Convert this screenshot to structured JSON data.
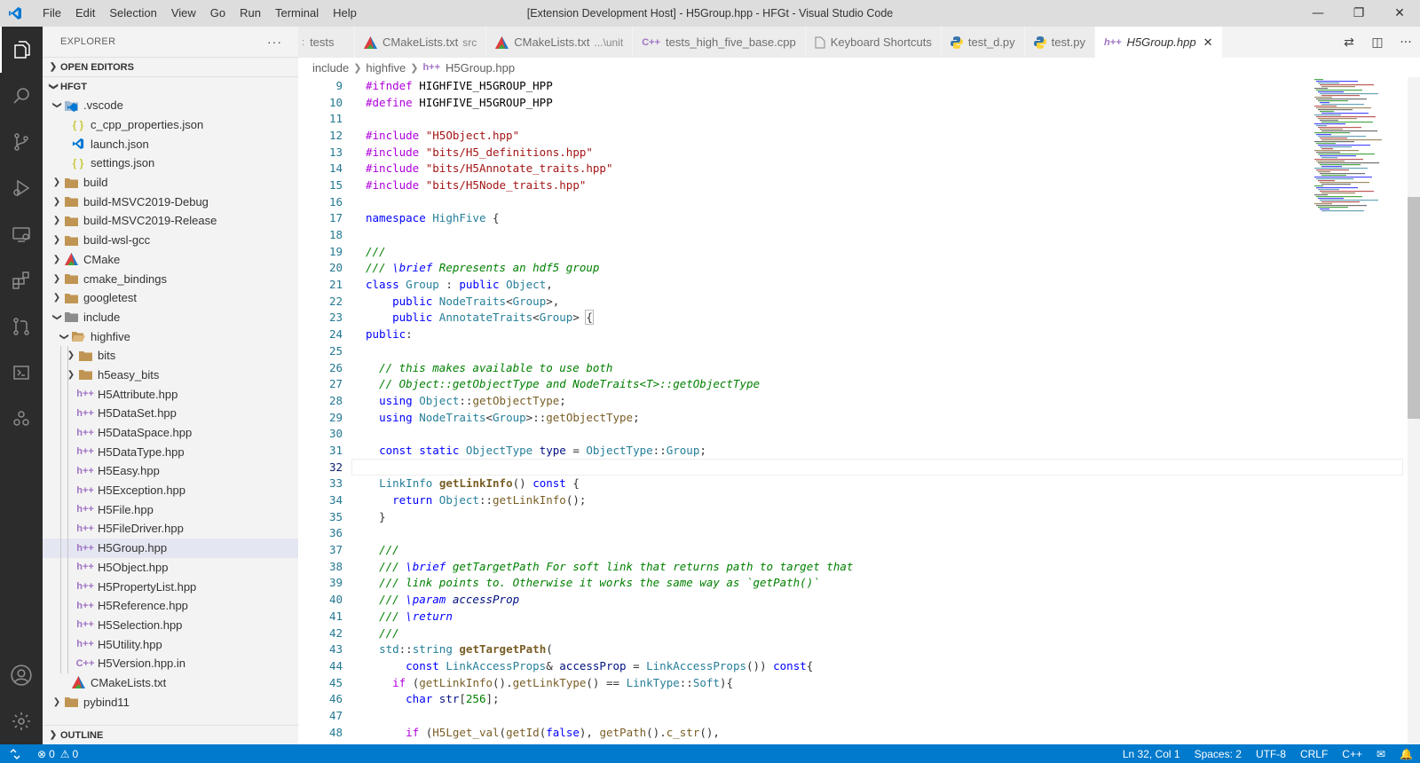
{
  "titlebar": {
    "menu": [
      "File",
      "Edit",
      "Selection",
      "View",
      "Go",
      "Run",
      "Terminal",
      "Help"
    ],
    "title": "[Extension Development Host] - H5Group.hpp - HFGt - Visual Studio Code"
  },
  "sidebar": {
    "header": "EXPLORER",
    "open_editors": "OPEN EDITORS",
    "workspace": "HFGT",
    "outline": "OUTLINE",
    "tree": [
      {
        "label": ".vscode",
        "depth": 1,
        "kind": "folder-vscode",
        "expanded": true
      },
      {
        "label": "c_cpp_properties.json",
        "depth": 2,
        "kind": "json"
      },
      {
        "label": "launch.json",
        "depth": 2,
        "kind": "vscode"
      },
      {
        "label": "settings.json",
        "depth": 2,
        "kind": "json"
      },
      {
        "label": "build",
        "depth": 1,
        "kind": "folder",
        "expanded": false
      },
      {
        "label": "build-MSVC2019-Debug",
        "depth": 1,
        "kind": "folder",
        "expanded": false
      },
      {
        "label": "build-MSVC2019-Release",
        "depth": 1,
        "kind": "folder",
        "expanded": false
      },
      {
        "label": "build-wsl-gcc",
        "depth": 1,
        "kind": "folder",
        "expanded": false
      },
      {
        "label": "CMake",
        "depth": 1,
        "kind": "folder-cmake",
        "expanded": false
      },
      {
        "label": "cmake_bindings",
        "depth": 1,
        "kind": "folder",
        "expanded": false
      },
      {
        "label": "googletest",
        "depth": 1,
        "kind": "folder",
        "expanded": false
      },
      {
        "label": "include",
        "depth": 1,
        "kind": "folder-include",
        "expanded": true
      },
      {
        "label": "highfive",
        "depth": 2,
        "kind": "folder-open",
        "expanded": true
      },
      {
        "label": "bits",
        "depth": 3,
        "kind": "folder",
        "expanded": false
      },
      {
        "label": "h5easy_bits",
        "depth": 3,
        "kind": "folder",
        "expanded": false
      },
      {
        "label": "H5Attribute.hpp",
        "depth": 3,
        "kind": "hpp"
      },
      {
        "label": "H5DataSet.hpp",
        "depth": 3,
        "kind": "hpp"
      },
      {
        "label": "H5DataSpace.hpp",
        "depth": 3,
        "kind": "hpp"
      },
      {
        "label": "H5DataType.hpp",
        "depth": 3,
        "kind": "hpp"
      },
      {
        "label": "H5Easy.hpp",
        "depth": 3,
        "kind": "hpp"
      },
      {
        "label": "H5Exception.hpp",
        "depth": 3,
        "kind": "hpp"
      },
      {
        "label": "H5File.hpp",
        "depth": 3,
        "kind": "hpp"
      },
      {
        "label": "H5FileDriver.hpp",
        "depth": 3,
        "kind": "hpp"
      },
      {
        "label": "H5Group.hpp",
        "depth": 3,
        "kind": "hpp",
        "selected": true
      },
      {
        "label": "H5Object.hpp",
        "depth": 3,
        "kind": "hpp"
      },
      {
        "label": "H5PropertyList.hpp",
        "depth": 3,
        "kind": "hpp"
      },
      {
        "label": "H5Reference.hpp",
        "depth": 3,
        "kind": "hpp"
      },
      {
        "label": "H5Selection.hpp",
        "depth": 3,
        "kind": "hpp"
      },
      {
        "label": "H5Utility.hpp",
        "depth": 3,
        "kind": "hpp"
      },
      {
        "label": "H5Version.hpp.in",
        "depth": 3,
        "kind": "cpp"
      },
      {
        "label": "CMakeLists.txt",
        "depth": 2,
        "kind": "cmake"
      },
      {
        "label": "pybind11",
        "depth": 1,
        "kind": "folder",
        "expanded": false
      }
    ]
  },
  "tabs": [
    {
      "label": "tests",
      "kind": "partial",
      "desc": ""
    },
    {
      "label": "CMakeLists.txt",
      "kind": "cmake",
      "desc": "src"
    },
    {
      "label": "CMakeLists.txt",
      "kind": "cmake",
      "desc": "...\\unit"
    },
    {
      "label": "tests_high_five_base.cpp",
      "kind": "cpp",
      "desc": ""
    },
    {
      "label": "Keyboard Shortcuts",
      "kind": "file",
      "desc": ""
    },
    {
      "label": "test_d.py",
      "kind": "python",
      "desc": ""
    },
    {
      "label": "test.py",
      "kind": "python",
      "desc": ""
    },
    {
      "label": "H5Group.hpp",
      "kind": "hpp",
      "desc": "",
      "active": true
    }
  ],
  "breadcrumb": [
    "include",
    "highfive",
    "H5Group.hpp"
  ],
  "editor": {
    "current_line": 32,
    "lines": [
      {
        "n": 9,
        "html": "<span class='p'>#ifndef</span> <span class='d'>HIGHFIVE_H5GROUP_HPP</span>"
      },
      {
        "n": 10,
        "html": "<span class='p'>#define</span> <span class='d'>HIGHFIVE_H5GROUP_HPP</span>"
      },
      {
        "n": 11,
        "html": ""
      },
      {
        "n": 12,
        "html": "<span class='p'>#include</span> <span class='s'>\"H5Object.hpp\"</span>"
      },
      {
        "n": 13,
        "html": "<span class='p'>#include</span> <span class='s'>\"bits/H5_definitions.hpp\"</span>"
      },
      {
        "n": 14,
        "html": "<span class='p'>#include</span> <span class='s'>\"bits/H5Annotate_traits.hpp\"</span>"
      },
      {
        "n": 15,
        "html": "<span class='p'>#include</span> <span class='s'>\"bits/H5Node_traits.hpp\"</span>"
      },
      {
        "n": 16,
        "html": ""
      },
      {
        "n": 17,
        "html": "<span class='k'>namespace</span> <span class='t'>HighFive</span> {"
      },
      {
        "n": 18,
        "html": ""
      },
      {
        "n": 19,
        "html": "<span class='cmt'>///</span>"
      },
      {
        "n": 20,
        "html": "<span class='cmt'>/// </span><span class='k' style='font-style:italic'>\\brief</span><span class='cmt'> Represents an hdf5 group</span>"
      },
      {
        "n": 21,
        "html": "<span class='k'>class</span> <span class='t'>Group</span> : <span class='k'>public</span> <span class='t'>Object</span>,"
      },
      {
        "n": 22,
        "html": "    <span class='k'>public</span> <span class='t'>NodeTraits</span>&lt;<span class='t'>Group</span>&gt;,"
      },
      {
        "n": 23,
        "html": "    <span class='k'>public</span> <span class='t'>AnnotateTraits</span>&lt;<span class='t'>Group</span>&gt; <span style='outline:1px solid #b9b9b9'>{</span>"
      },
      {
        "n": 24,
        "html": "<span class='k'>public</span>:"
      },
      {
        "n": 25,
        "html": ""
      },
      {
        "n": 26,
        "html": "  <span class='cmt'>// this makes available to use both</span>"
      },
      {
        "n": 27,
        "html": "  <span class='cmt'>// Object::getObjectType and NodeTraits&lt;T&gt;::getObjectType</span>"
      },
      {
        "n": 28,
        "html": "  <span class='k'>using</span> <span class='t'>Object</span>::<span class='f'>getObjectType</span>;"
      },
      {
        "n": 29,
        "html": "  <span class='k'>using</span> <span class='t'>NodeTraits</span>&lt;<span class='t'>Group</span>&gt;::<span class='f'>getObjectType</span>;"
      },
      {
        "n": 30,
        "html": ""
      },
      {
        "n": 31,
        "html": "  <span class='k'>const</span> <span class='k'>static</span> <span class='t'>ObjectType</span> <span class='m'>type</span> = <span class='t'>ObjectType</span>::<span class='t'>Group</span>;"
      },
      {
        "n": 32,
        "html": ""
      },
      {
        "n": 33,
        "html": "  <span class='t'>LinkInfo</span> <span class='f' style='font-weight:bold'>getLinkInfo</span>() <span class='k'>const</span> {"
      },
      {
        "n": 34,
        "html": "    <span class='k'>return</span> <span class='t'>Object</span>::<span class='f'>getLinkInfo</span>();"
      },
      {
        "n": 35,
        "html": "  }"
      },
      {
        "n": 36,
        "html": ""
      },
      {
        "n": 37,
        "html": "  <span class='cmt'>///</span>"
      },
      {
        "n": 38,
        "html": "  <span class='cmt'>/// </span><span class='k' style='font-style:italic'>\\brief</span><span class='cmt'> getTargetPath For soft link that returns path to target that</span>"
      },
      {
        "n": 39,
        "html": "  <span class='cmt'>/// link points to. Otherwise it works the same way as `getPath()`</span>"
      },
      {
        "n": 40,
        "html": "  <span class='cmt'>/// </span><span class='k' style='font-style:italic'>\\param</span><span class='cmt'> </span><span class='m' style='font-style:italic'>accessProp</span>"
      },
      {
        "n": 41,
        "html": "  <span class='cmt'>/// </span><span class='k' style='font-style:italic'>\\return</span>"
      },
      {
        "n": 42,
        "html": "  <span class='cmt'>///</span>"
      },
      {
        "n": 43,
        "html": "  <span class='t'>std</span>::<span class='t'>string</span> <span class='f' style='font-weight:bold'>getTargetPath</span>("
      },
      {
        "n": 44,
        "html": "      <span class='k'>const</span> <span class='t'>LinkAccessProps</span>&amp; <span class='m'>accessProp</span> = <span class='t'>LinkAccessProps</span>()) <span class='k'>const</span>{"
      },
      {
        "n": 45,
        "html": "    <span class='p'>if</span> (<span class='f'>getLinkInfo</span>().<span class='f'>getLinkType</span>() == <span class='t'>LinkType</span>::<span class='t'>Soft</span>){"
      },
      {
        "n": 46,
        "html": "      <span class='k'>char</span> <span class='m'>str</span>[<span class='c'>256</span>];"
      },
      {
        "n": 47,
        "html": ""
      },
      {
        "n": 48,
        "html": "      <span class='p'>if</span> (<span class='f'>H5Lget_val</span>(<span class='f'>getId</span>(<span class='k'>false</span>), <span class='f'>getPath</span>().<span class='f'>c_str</span>(),"
      }
    ]
  },
  "statusbar": {
    "errors": "0",
    "warnings": "0",
    "position": "Ln 32, Col 1",
    "spaces": "Spaces: 2",
    "encoding": "UTF-8",
    "eol": "CRLF",
    "language": "C++"
  }
}
